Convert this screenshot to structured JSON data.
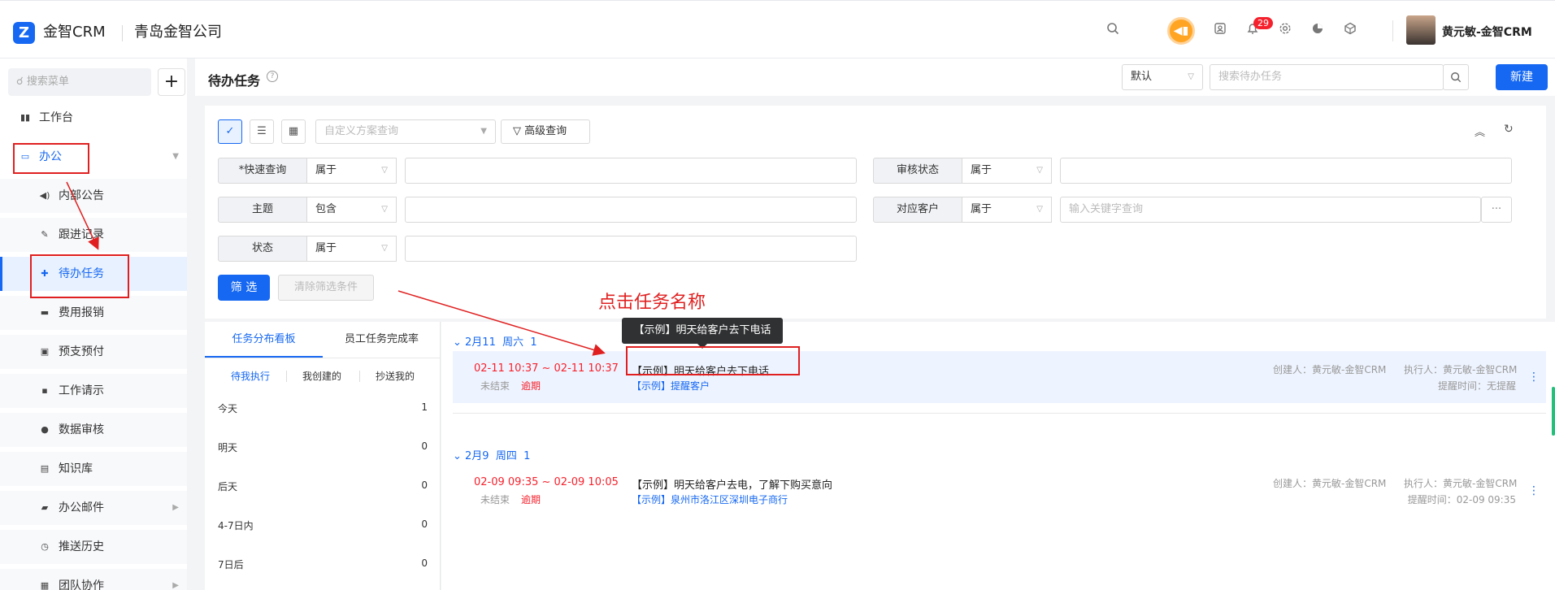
{
  "topbar": {
    "logo_letter": "Z",
    "brand": "金智CRM",
    "company": "青岛金智公司",
    "icons": [
      "search-icon",
      "speaker-icon",
      "contacts-icon",
      "bell-icon",
      "gear-icon",
      "pie-chart-icon",
      "cube-icon"
    ],
    "notification_count": "29",
    "user_name": "黄元敏-金智CRM"
  },
  "sidebar": {
    "search_placeholder": "搜索菜单",
    "plus": "+",
    "items": [
      {
        "label": "工作台",
        "icon": "dashboard-icon"
      },
      {
        "label": "办公",
        "icon": "monitor-icon"
      },
      {
        "label": "内部公告",
        "icon": "speaker-icon"
      },
      {
        "label": "跟进记录",
        "icon": "edit-icon"
      },
      {
        "label": "待办任务",
        "icon": "pin-icon"
      },
      {
        "label": "费用报销",
        "icon": "card-icon"
      },
      {
        "label": "预支预付",
        "icon": "wallet-icon"
      },
      {
        "label": "工作请示",
        "icon": "message-icon"
      },
      {
        "label": "数据审核",
        "icon": "user-icon"
      },
      {
        "label": "知识库",
        "icon": "book-icon"
      },
      {
        "label": "办公邮件",
        "icon": "folder-icon"
      },
      {
        "label": "推送历史",
        "icon": "clock-icon"
      },
      {
        "label": "团队协作",
        "icon": "team-icon"
      }
    ]
  },
  "header": {
    "title": "待办任务",
    "view_select": "默认",
    "search_placeholder": "搜索待办任务",
    "new_button": "新建"
  },
  "filter": {
    "scheme_placeholder": "自定义方案查询",
    "advanced": "高级查询",
    "rows": [
      {
        "label": "*快速查询",
        "op": "属于",
        "value": ""
      },
      {
        "label": "主题",
        "op": "包含",
        "value": ""
      },
      {
        "label": "状态",
        "op": "属于",
        "value": ""
      },
      {
        "label": "审核状态",
        "op": "属于",
        "value": ""
      },
      {
        "label": "对应客户",
        "op": "属于",
        "value": "输入关键字查询"
      }
    ],
    "more": "···",
    "filter_button": "筛 选",
    "clear_button": "清除筛选条件"
  },
  "left_panel": {
    "tabs": [
      "任务分布看板",
      "员工任务完成率"
    ],
    "subtabs": [
      "待我执行",
      "我创建的",
      "抄送我的"
    ],
    "counts": [
      {
        "label": "今天",
        "value": "1"
      },
      {
        "label": "明天",
        "value": "0"
      },
      {
        "label": "后天",
        "value": "0"
      },
      {
        "label": "4-7日内",
        "value": "0"
      },
      {
        "label": "7日后",
        "value": "0"
      }
    ]
  },
  "groups": [
    {
      "date": "2月11",
      "weekday": "周六",
      "count": "1",
      "task": {
        "time": "02-11 10:37 ~ 02-11 10:37",
        "status": "未结束",
        "overdue": "逾期",
        "name": "【示例】明天给客户去下电话",
        "customer": "【示例】提醒客户",
        "creator": "创建人：黄元敏-金智CRM",
        "executor": "执行人：黄元敏-金智CRM",
        "remind": "提醒时间：无提醒"
      }
    },
    {
      "date": "2月9",
      "weekday": "周四",
      "count": "1",
      "task": {
        "time": "02-09 09:35 ~ 02-09 10:05",
        "status": "未结束",
        "overdue": "逾期",
        "name": "【示例】明天给客户去电，了解下购买意向",
        "customer": "【示例】泉州市洛江区深圳电子商行",
        "creator": "创建人：黄元敏-金智CRM",
        "executor": "执行人：黄元敏-金智CRM",
        "remind": "提醒时间：02-09 09:35"
      }
    }
  ],
  "tooltip": "【示例】明天给客户去下电话",
  "annotation": "点击任务名称",
  "colors": {
    "accent": "#1668f2",
    "danger": "#f5222d",
    "annotation": "#e02020"
  }
}
